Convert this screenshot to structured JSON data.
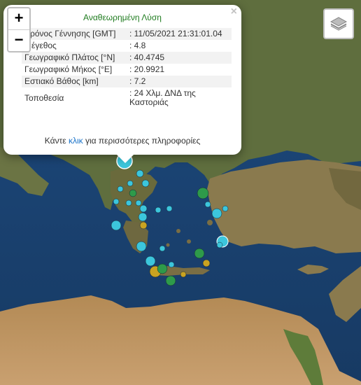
{
  "popup": {
    "title": "Αναθεωρημένη Λύση",
    "rows": [
      {
        "label": "Χρόνος Γέννησης [GMT]",
        "value": ": 11/05/2021 21:31:01.04"
      },
      {
        "label": "Μέγεθος",
        "value": ": 4.8"
      },
      {
        "label": "Γεωγραφικό Πλάτος [°N]",
        "value": ": 40.4745"
      },
      {
        "label": "Γεωγραφικό Μήκος [°E]",
        "value": ": 20.9921"
      },
      {
        "label": "Εστιακό Βάθος [km]",
        "value": ": 7.2"
      },
      {
        "label": "Τοποθεσία",
        "value": ": 24 Χλμ. ΔΝΔ της Καστοριάς"
      }
    ],
    "more_prefix": "Κάντε",
    "more_link": "κλικ",
    "more_suffix": "για περισσότερες πληροφορίες",
    "close_glyph": "×"
  },
  "zoom": {
    "in": "+",
    "out": "−"
  },
  "icons": {
    "layers": "layers-icon",
    "close": "close-icon"
  },
  "colors": {
    "cyan": "#3cc6dc",
    "green": "#2e9a4a",
    "olive": "#c9a321",
    "popup_title": "#1e7b1e",
    "link": "#1a73c9"
  }
}
